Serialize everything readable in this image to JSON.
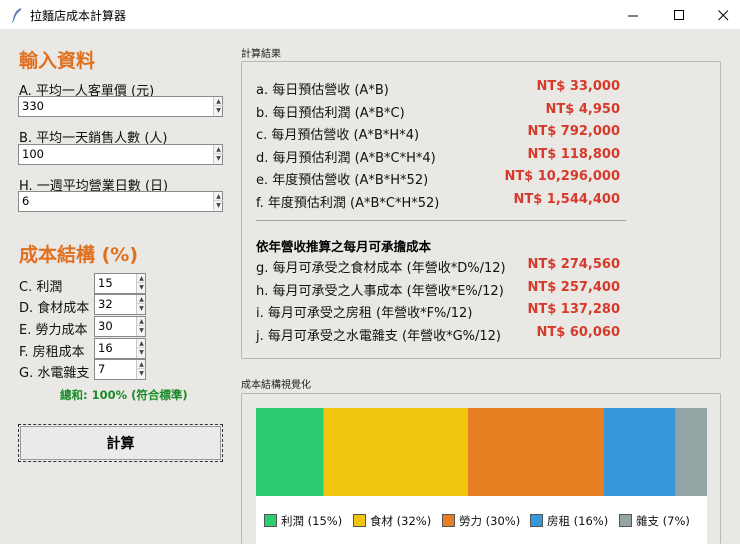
{
  "window": {
    "title": "拉麵店成本計算器"
  },
  "input": {
    "heading": "輸入資料",
    "fields": [
      {
        "label": "A. 平均一人客單價 (元)",
        "value": "330"
      },
      {
        "label": "B. 平均一天銷售人數 (人)",
        "value": "100"
      },
      {
        "label": "H. 一週平均營業日數 (日)",
        "value": "6"
      }
    ]
  },
  "cost": {
    "heading": "成本結構 (%)",
    "rows": [
      {
        "label": "C. 利潤",
        "value": "15"
      },
      {
        "label": "D. 食材成本",
        "value": "32"
      },
      {
        "label": "E. 勞力成本",
        "value": "30"
      },
      {
        "label": "F. 房租成本",
        "value": "16"
      },
      {
        "label": "G. 水電雜支",
        "value": "7"
      }
    ],
    "total": "總和: 100% (符合標準)"
  },
  "calc_button": "計算",
  "results": {
    "group_label": "計算結果",
    "rows": [
      {
        "label": "a. 每日預估營收 (A*B)",
        "amount": "NT$ 33,000"
      },
      {
        "label": "b. 每日預估利潤 (A*B*C)",
        "amount": "NT$ 4,950"
      },
      {
        "label": "c. 每月預估營收 (A*B*H*4)",
        "amount": "NT$ 792,000"
      },
      {
        "label": "d. 每月預估利潤 (A*B*C*H*4)",
        "amount": "NT$ 118,800"
      },
      {
        "label": "e. 年度預估營收 (A*B*H*52)",
        "amount": "NT$ 10,296,000"
      },
      {
        "label": "f. 年度預估利潤 (A*B*C*H*52)",
        "amount": "NT$ 1,544,400"
      }
    ],
    "subheading": "依年營收推算之每月可承擔成本",
    "monthly": [
      {
        "label": "g. 每月可承受之食材成本 (年營收*D%/12)",
        "amount": "NT$ 274,560"
      },
      {
        "label": "h. 每月可承受之人事成本 (年營收*E%/12)",
        "amount": "NT$ 257,400"
      },
      {
        "label": "i. 每月可承受之房租 (年營收*F%/12)",
        "amount": "NT$ 137,280"
      },
      {
        "label": "j. 每月可承受之水電雜支 (年營收*G%/12)",
        "amount": "NT$ 60,060"
      }
    ]
  },
  "chart_group_label": "成本結構視覺化",
  "chart_data": {
    "type": "bar",
    "stacked": true,
    "orientation": "horizontal",
    "series": [
      {
        "name": "利潤",
        "value": 15,
        "color": "#2ecc71"
      },
      {
        "name": "食材",
        "value": 32,
        "color": "#f1c40f"
      },
      {
        "name": "勞力",
        "value": 30,
        "color": "#e67e22"
      },
      {
        "name": "房租",
        "value": 16,
        "color": "#3498db"
      },
      {
        "name": "雜支",
        "value": 7,
        "color": "#95a5a6"
      }
    ],
    "legend": [
      "利潤 (15%)",
      "食材 (32%)",
      "勞力 (30%)",
      "房租 (16%)",
      "雜支 (7%)"
    ]
  }
}
